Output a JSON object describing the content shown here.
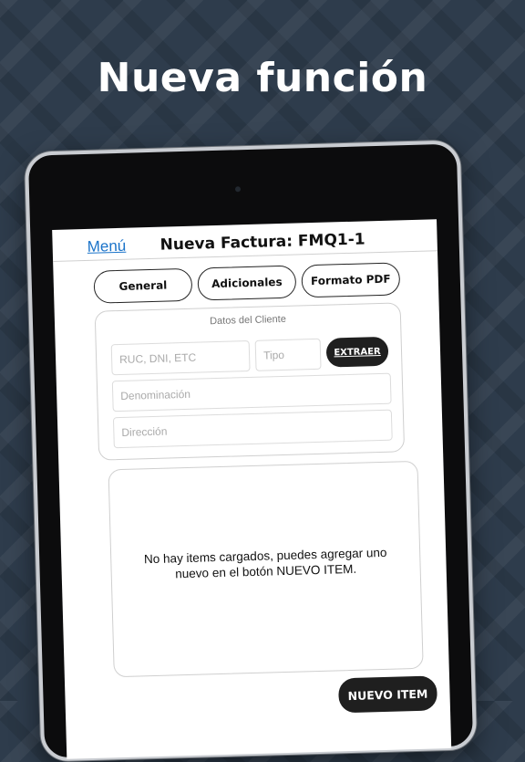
{
  "headline": "Nueva función",
  "navbar": {
    "menu_label": "Menú",
    "title": "Nueva Factura: FMQ1-1"
  },
  "tabs": [
    {
      "label": "General"
    },
    {
      "label": "Adicionales"
    },
    {
      "label": "Formato PDF"
    }
  ],
  "client_section": {
    "label": "Datos del Cliente",
    "ruc_placeholder": "RUC, DNI, ETC",
    "tipo_placeholder": "Tipo",
    "extract_button": "EXTRAER",
    "denominacion_placeholder": "Denominación",
    "direccion_placeholder": "Dirección"
  },
  "items_section": {
    "empty_message": "No hay items cargados, puedes agregar uno nuevo en el botón NUEVO ITEM."
  },
  "new_item_button": "NUEVO ITEM"
}
